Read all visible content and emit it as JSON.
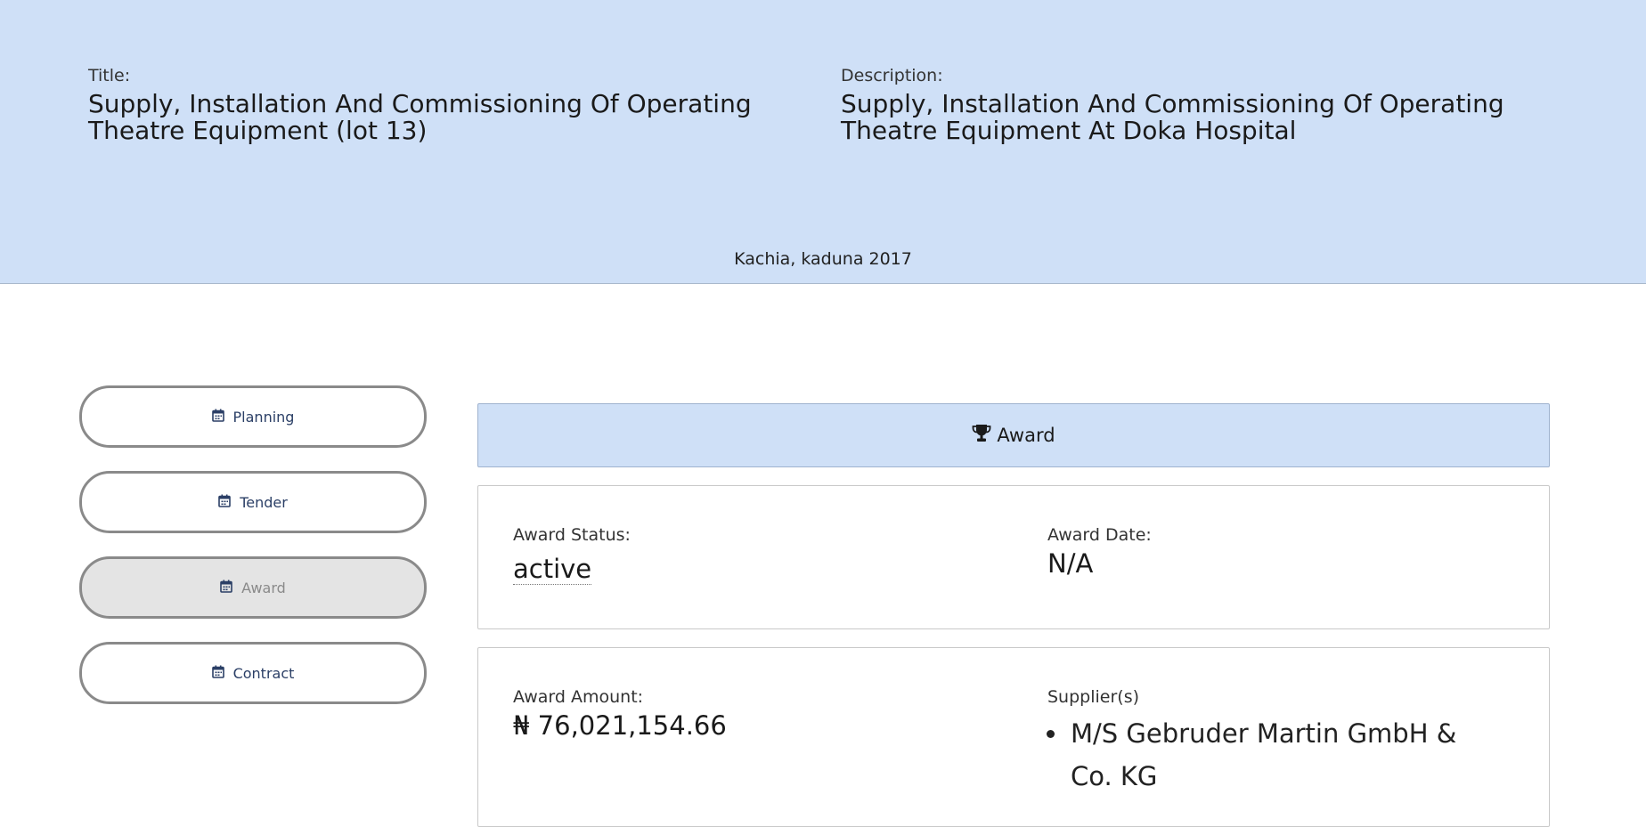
{
  "header": {
    "title_label": "Title:",
    "title": "Supply, Installation And Commissioning Of Operating Theatre Equipment (lot 13)",
    "description_label": "Description:",
    "description": "Supply, Installation And Commissioning Of Operating Theatre Equipment At Doka Hospital",
    "location": "Kachia, kaduna 2017"
  },
  "nav": {
    "items": [
      {
        "label": "Planning",
        "icon": "calendar-icon",
        "active": false
      },
      {
        "label": "Tender",
        "icon": "calendar-icon",
        "active": false
      },
      {
        "label": "Award",
        "icon": "calendar-icon",
        "active": true
      },
      {
        "label": "Contract",
        "icon": "calendar-icon",
        "active": false
      }
    ]
  },
  "panel": {
    "title": "Award",
    "icon": "trophy-icon"
  },
  "award": {
    "status_label": "Award Status:",
    "status": "active",
    "date_label": "Award Date:",
    "date": "N/A",
    "amount_label": "Award Amount:",
    "amount": "₦ 76,021,154.66",
    "suppliers_label": "Supplier(s)",
    "suppliers": [
      "M/S Gebruder Martin GmbH & Co. KG"
    ]
  },
  "colors": {
    "header_bg": "#cfe0f7",
    "nav_text": "#2b3f66",
    "nav_active_bg": "#e4e4e4"
  }
}
